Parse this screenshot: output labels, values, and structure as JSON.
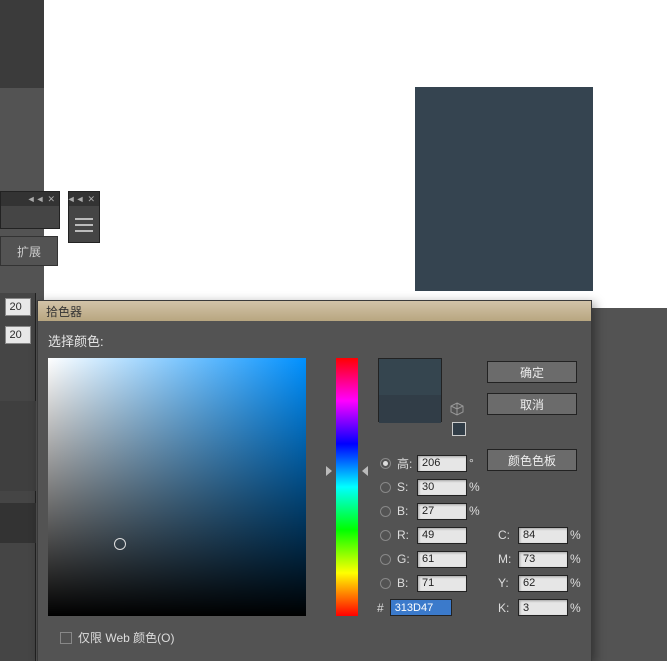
{
  "left_strip": {},
  "ext_tab": {
    "label": "扩展"
  },
  "side_inputs": {
    "a": "20",
    "b": "20"
  },
  "picker": {
    "title": "拾色器",
    "select_label": "选择颜色:",
    "buttons": {
      "ok": "确定",
      "cancel": "取消",
      "swatches": "颜色色板"
    },
    "hsb": {
      "h_label": "高:",
      "h_value": "206",
      "h_unit": "°",
      "s_label": "S:",
      "s_value": "30",
      "s_unit": "%",
      "b_label": "B:",
      "b_value": "27",
      "b_unit": "%"
    },
    "rgb": {
      "r_label": "R:",
      "r_value": "49",
      "g_label": "G:",
      "g_value": "61",
      "b_label": "B:",
      "b_value": "71"
    },
    "cmyk": {
      "c_label": "C:",
      "c_value": "84",
      "c_unit": "%",
      "m_label": "M:",
      "m_value": "73",
      "m_unit": "%",
      "y_label": "Y:",
      "y_value": "62",
      "y_unit": "%",
      "k_label": "K:",
      "k_value": "3",
      "k_unit": "%"
    },
    "hex": {
      "label": "#",
      "value": "313D47"
    },
    "web_only": "仅限 Web 颜色(O)",
    "colors": {
      "new": "#35454f",
      "old": "#313d47"
    }
  }
}
